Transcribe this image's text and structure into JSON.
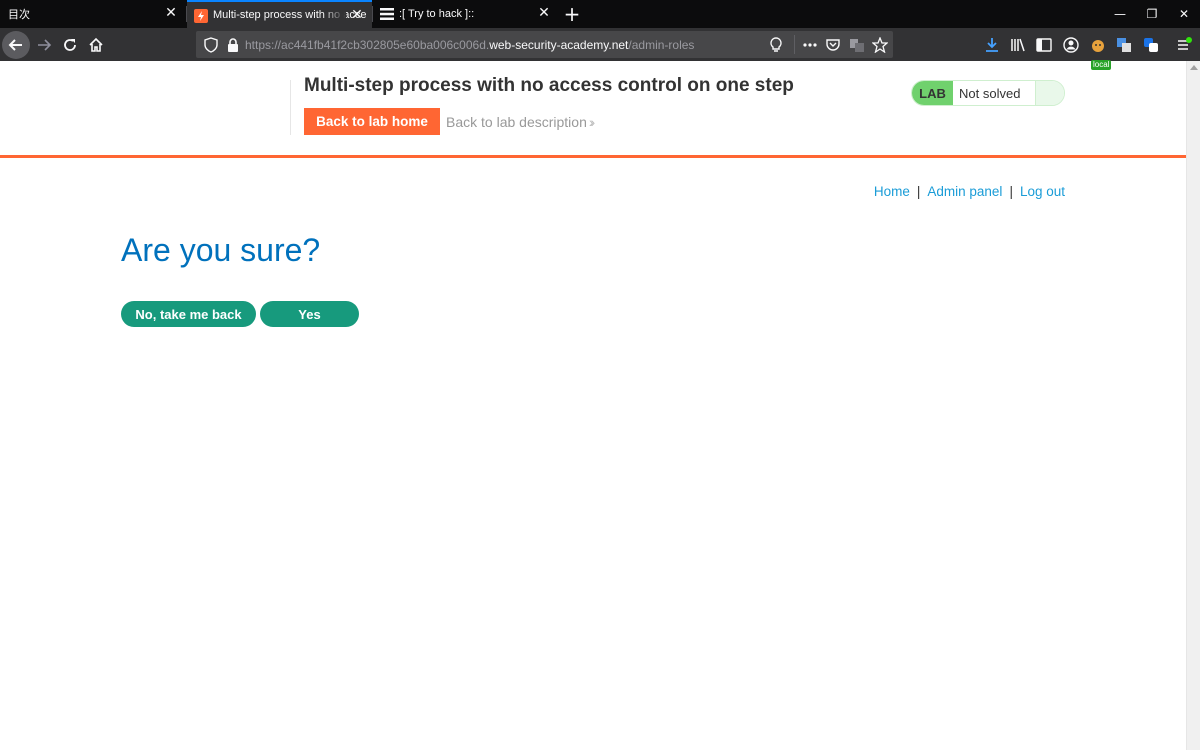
{
  "browser": {
    "tabs": [
      {
        "title": "目次",
        "active": false
      },
      {
        "title": "Multi-step process with no acce",
        "active": true
      },
      {
        "title": ":[ Try to hack ]::",
        "active": false
      }
    ],
    "url": {
      "prefix": "https://ac441fb41f2cb302805e60ba006c006d.",
      "host": "web-security-academy.net",
      "path": "/admin-roles"
    },
    "extension_badge": "local",
    "accent_color": "#0a84ff"
  },
  "header": {
    "lab_title": "Multi-step process with no access control on one step",
    "back_home_label": "Back to lab home",
    "back_description_label": "Back to lab description",
    "lab_badge": "LAB",
    "lab_status": "Not solved",
    "accent_color": "#ff6633"
  },
  "nav": {
    "home": "Home",
    "admin_panel": "Admin panel",
    "log_out": "Log out",
    "separator": "|"
  },
  "main": {
    "heading": "Are you sure?",
    "no_button": "No, take me back",
    "yes_button": "Yes",
    "button_color": "#179a7d"
  }
}
